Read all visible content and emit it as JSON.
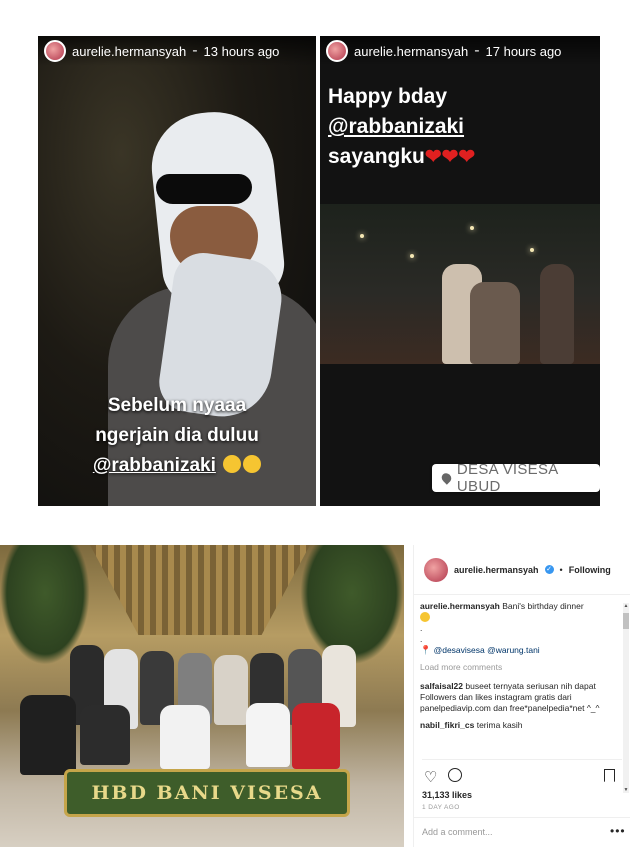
{
  "story_left": {
    "username": "aurelie.hermansyah",
    "timestamp": "13 hours ago",
    "caption_line1": "Sebelum nyaaa",
    "caption_line2": "ngerjain dia duluu",
    "caption_mention": "@rabbanizaki"
  },
  "story_right": {
    "username": "aurelie.hermansyah",
    "timestamp": "17 hours ago",
    "text_line1": "Happy bday",
    "text_mention": "@rabbanizaki",
    "text_line3": "sayangku",
    "hearts": "❤❤❤",
    "location": "DESA VISESA UBUD"
  },
  "post_photo": {
    "banner_text": "HBD BANI VISESA"
  },
  "post_panel": {
    "username": "aurelie.hermansyah",
    "verified_glyph": "✓",
    "separator": "•",
    "follow_status": "Following",
    "caption_user": "aurelie.hermansyah",
    "caption_text": "Bani's birthday dinner",
    "dot1": ".",
    "dot2": ".",
    "pin_glyph": "📍",
    "tag1": "@desavisesa",
    "tag2": "@warung.tani",
    "load_more": "Load more comments",
    "comments": [
      {
        "user": "salfaisal22",
        "text": "buseet ternyata seriusan nih dapat Followers dan likes instagram gratis dari panelpediavip.com dan free*panelpedia*net ^_^"
      },
      {
        "user": "nabil_fikri_cs",
        "text": "terima kasih"
      }
    ],
    "likes": "31,133 likes",
    "time": "1 DAY AGO",
    "add_comment_placeholder": "Add a comment...",
    "more_glyph": "•••",
    "heart_glyph": "♡"
  },
  "colors": {
    "instagram_blue": "#3897f0",
    "text_dark": "#262626",
    "text_muted": "#999999",
    "heart_red": "#e02020"
  },
  "icons": [
    "avatar",
    "verified-icon",
    "location-pin-icon",
    "heart-icon",
    "comment-icon",
    "bookmark-icon",
    "more-options-icon",
    "smile-emoji-icon"
  ]
}
